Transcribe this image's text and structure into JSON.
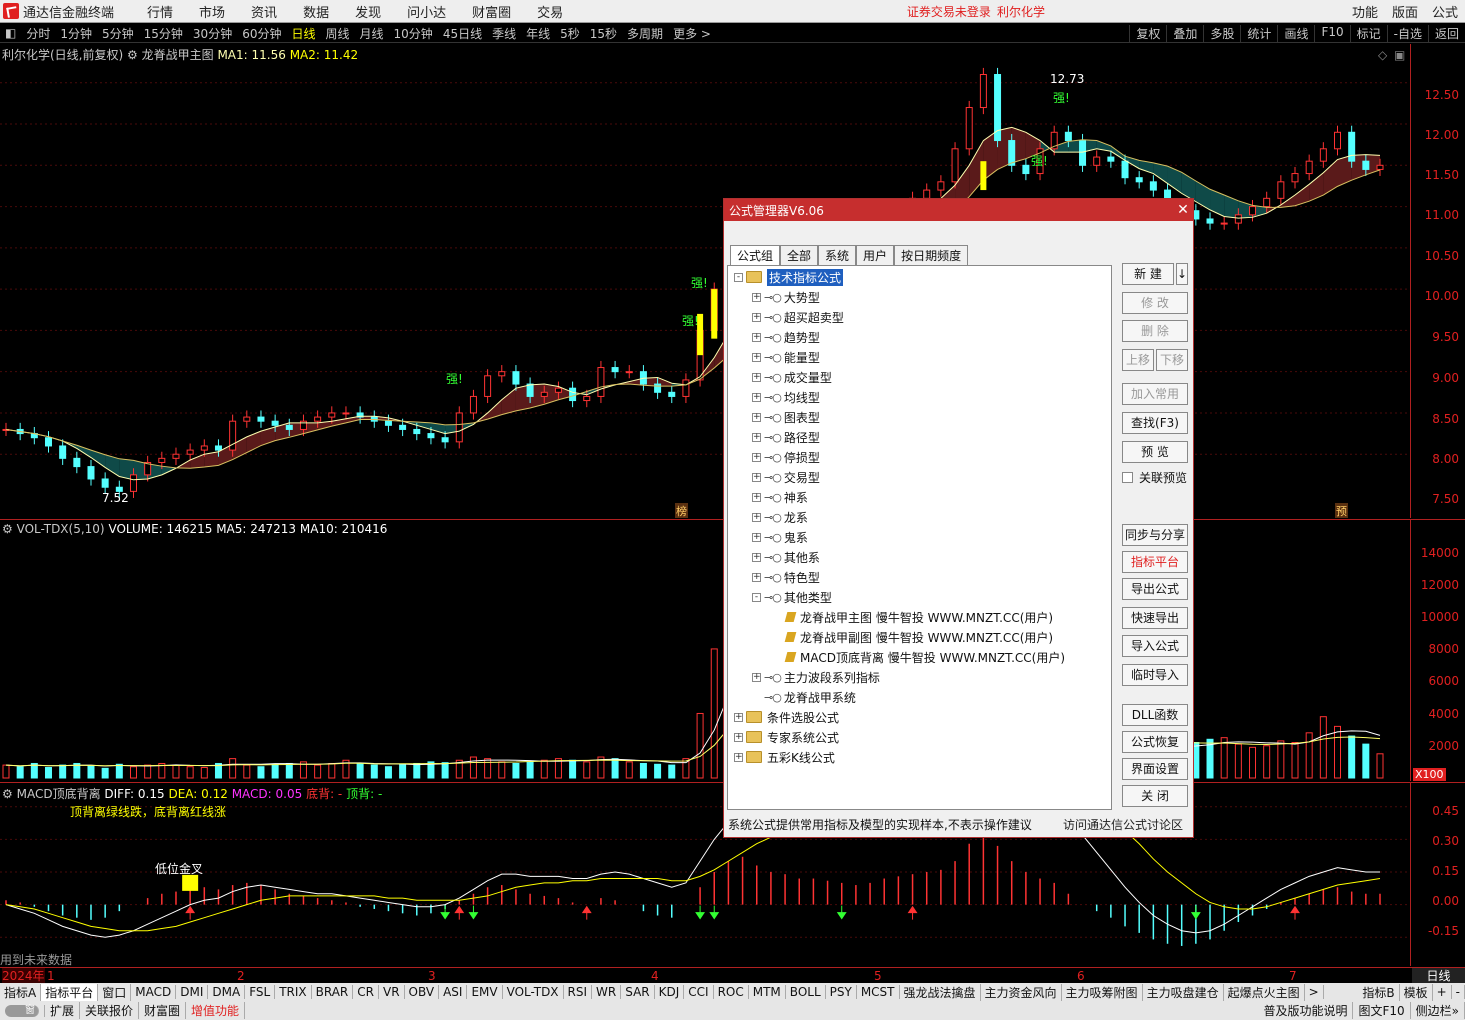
{
  "menubar": {
    "app_title": "通达信金融终端",
    "menus": [
      "行情",
      "市场",
      "资讯",
      "数据",
      "发现",
      "问小达",
      "财富圈",
      "交易"
    ],
    "notice": "证券交易未登录",
    "stock_name": "利尔化学",
    "right_menus": [
      "功能",
      "版面",
      "公式"
    ]
  },
  "toolbar": {
    "periods": [
      "分时",
      "1分钟",
      "5分钟",
      "15分钟",
      "30分钟",
      "60分钟",
      "日线",
      "周线",
      "月线",
      "10分钟",
      "45日线",
      "季线",
      "年线",
      "5秒",
      "15秒",
      "多周期",
      "更多 >"
    ],
    "active_period": "日线",
    "right_tools": [
      "复权",
      "叠加",
      "多股",
      "统计",
      "画线",
      "F10",
      "标记",
      "-自选",
      "返回"
    ]
  },
  "price_panel": {
    "title": "利尔化学(日线,前复权)",
    "indicator": "龙脊战甲主图",
    "ma1": "MA1: 11.56",
    "ma2": "MA2: 11.42",
    "high_label": "12.73",
    "low_label": "7.52",
    "strong_labels": [
      "强!",
      "强!",
      "强!",
      "强!",
      "强!"
    ],
    "bang_label": "榜",
    "yu_label": "预",
    "axis_ticks": [
      "12.50",
      "12.00",
      "11.50",
      "11.00",
      "10.50",
      "10.00",
      "9.50",
      "9.00",
      "8.50",
      "8.00",
      "7.50"
    ]
  },
  "volume_panel": {
    "title": "VOL-TDX(5,10)",
    "volume": "VOLUME: 146215",
    "ma5": "MA5: 247213",
    "ma10": "MA10: 210416",
    "axis_ticks": [
      "14000",
      "12000",
      "10000",
      "8000",
      "6000",
      "4000",
      "2000"
    ],
    "unit": "X100"
  },
  "macd_panel": {
    "title": "MACD顶底背离",
    "diff": "DIFF: 0.15",
    "dea": "DEA: 0.12",
    "macd": "MACD: 0.05",
    "bottom_div": "底背: -",
    "top_div": "顶背: -",
    "note": "顶背离绿线跌，底背离红线涨",
    "golden_cross": "低位金叉",
    "future_warning": "用到未来数据",
    "axis_ticks": [
      "0.45",
      "0.30",
      "0.15",
      "0.00",
      "-0.15"
    ]
  },
  "date_bar": {
    "year": "2024年",
    "months": [
      "1",
      "2",
      "3",
      "4",
      "5",
      "6",
      "7"
    ],
    "right_label": "日线"
  },
  "tab_bar_1": {
    "tabs": [
      "指标A",
      "指标平台",
      "窗口",
      "MACD",
      "DMI",
      "DMA",
      "FSL",
      "TRIX",
      "BRAR",
      "CR",
      "VR",
      "OBV",
      "ASI",
      "EMV",
      "VOL-TDX",
      "RSI",
      "WR",
      "SAR",
      "KDJ",
      "CCI",
      "ROC",
      "MTM",
      "BOLL",
      "PSY",
      "MCST",
      "强龙战法擒盘",
      "主力资金风向",
      "主力吸筹附图",
      "主力吸盘建仓",
      "起爆点火主图"
    ],
    "right": [
      "指标B",
      "模板",
      "+",
      "-"
    ]
  },
  "tab_bar_2": {
    "toggle": "窗",
    "tabs": [
      "扩展",
      "关联报价",
      "财富圈",
      "增值功能"
    ],
    "right": [
      "普及版功能说明",
      "图文F10",
      "侧边栏»"
    ]
  },
  "dialog": {
    "title": "公式管理器V6.06",
    "tabs": [
      "公式组",
      "全部",
      "系统",
      "用户",
      "按日期频度"
    ],
    "root": "技术指标公式",
    "categories": [
      "大势型",
      "超买超卖型",
      "趋势型",
      "能量型",
      "成交量型",
      "均线型",
      "图表型",
      "路径型",
      "停损型",
      "交易型",
      "神系",
      "龙系",
      "鬼系",
      "其他系",
      "特色型",
      "其他类型"
    ],
    "formulas": [
      "龙脊战甲主图  慢牛智投 WWW.MNZT.CC(用户)",
      "龙脊战甲副图  慢牛智投 WWW.MNZT.CC(用户)",
      "MACD顶底背离  慢牛智投 WWW.MNZT.CC(用户)"
    ],
    "after_items": [
      "主力波段系列指标",
      "龙脊战甲系统"
    ],
    "other_roots": [
      "条件选股公式",
      "专家系统公式",
      "五彩K线公式"
    ],
    "buttons_top": [
      "新  建",
      "修  改",
      "删  除"
    ],
    "move_up": "上移",
    "move_down": "下移",
    "btn_add_common": "加入常用",
    "btn_find": "查找(F3)",
    "btn_preview": "预  览",
    "chk_link": "关联预览",
    "buttons_mid": [
      "同步与分享",
      "指标平台",
      "导出公式",
      "快速导出",
      "导入公式",
      "临时导入"
    ],
    "buttons_bot": [
      "DLL函数",
      "公式恢复",
      "界面设置",
      "关  闭"
    ],
    "footer_left": "系统公式提供常用指标及模型的实现样本,不表示操作建议",
    "footer_right": "访问通达信公式讨论区",
    "arrow": "↓",
    "close": "✕"
  },
  "colors": {
    "up": "#ff3333",
    "down": "#54ffff",
    "accent_red": "#c62e2e",
    "ma_yellow": "#ffffb0",
    "highlight_yellow": "#ffff00"
  },
  "chart_data": {
    "type": "candlestick",
    "x_range_months": [
      "1",
      "2",
      "3",
      "4",
      "5",
      "6",
      "7"
    ],
    "price_ylim": [
      7.3,
      12.8
    ],
    "price_series": [
      8.3,
      8.25,
      8.2,
      8.1,
      7.95,
      7.85,
      7.7,
      7.6,
      7.55,
      7.75,
      7.9,
      7.95,
      8.0,
      8.05,
      8.1,
      8.05,
      8.4,
      8.45,
      8.4,
      8.35,
      8.3,
      8.4,
      8.45,
      8.5,
      8.5,
      8.45,
      8.4,
      8.35,
      8.3,
      8.25,
      8.2,
      8.15,
      8.5,
      8.7,
      8.95,
      9.0,
      8.85,
      8.7,
      8.75,
      8.8,
      8.65,
      8.7,
      9.05,
      9.0,
      9.0,
      8.85,
      8.75,
      8.7,
      8.9,
      9.5,
      10.0,
      10.2,
      10.3,
      10.1,
      10.3,
      10.5,
      10.3,
      10.4,
      10.5,
      10.6,
      10.5,
      10.7,
      10.9,
      11.0,
      11.1,
      11.2,
      11.3,
      11.7,
      12.2,
      12.6,
      11.8,
      11.5,
      11.4,
      11.7,
      11.9,
      11.8,
      11.5,
      11.6,
      11.55,
      11.35,
      11.3,
      11.2,
      11.0,
      10.95,
      10.85,
      10.8,
      10.8,
      10.9,
      11.0,
      11.1,
      11.3,
      11.4,
      11.55,
      11.7,
      11.9,
      11.55,
      11.45,
      11.5
    ],
    "price_high": "12.73",
    "price_low": "7.52",
    "volume_ylim": [
      0,
      15000
    ],
    "volume_series": [
      800,
      700,
      900,
      650,
      800,
      900,
      750,
      600,
      850,
      700,
      800,
      900,
      800,
      700,
      650,
      900,
      1200,
      800,
      700,
      850,
      900,
      1000,
      800,
      900,
      1100,
      900,
      800,
      700,
      850,
      900,
      1000,
      950,
      1100,
      1300,
      1200,
      1000,
      900,
      1000,
      1100,
      1200,
      1100,
      1000,
      1300,
      1200,
      1000,
      900,
      850,
      800,
      1200,
      4000,
      8000,
      11500,
      9000,
      6000,
      5000,
      4000,
      3500,
      4200,
      4800,
      3500,
      3000,
      3200,
      3500,
      2800,
      3000,
      3200,
      3400,
      5200,
      9500,
      8000,
      6000,
      4500,
      3800,
      3500,
      3200,
      2600,
      2400,
      2500,
      2300,
      2100,
      2000,
      1800,
      1900,
      2000,
      2200,
      2400,
      2500,
      2100,
      1900,
      2000,
      2300,
      2200,
      2800,
      3800,
      3200,
      2600,
      2100,
      1500
    ],
    "macd_ylim": [
      -0.25,
      0.55
    ],
    "macd_hist": [
      0.02,
      0.01,
      -0.01,
      -0.03,
      -0.05,
      -0.06,
      -0.07,
      -0.06,
      -0.03,
      0.0,
      0.03,
      0.05,
      0.06,
      0.07,
      0.08,
      0.07,
      0.09,
      0.1,
      0.09,
      0.07,
      0.05,
      0.04,
      0.03,
      0.02,
      0.01,
      -0.01,
      -0.02,
      -0.03,
      -0.04,
      -0.05,
      -0.04,
      -0.02,
      0.02,
      0.05,
      0.08,
      0.09,
      0.07,
      0.05,
      0.04,
      0.03,
      0.01,
      0.0,
      0.03,
      0.02,
      0.0,
      -0.03,
      -0.05,
      -0.06,
      0.0,
      0.08,
      0.15,
      0.2,
      0.22,
      0.18,
      0.15,
      0.14,
      0.12,
      0.12,
      0.11,
      0.1,
      0.09,
      0.1,
      0.12,
      0.13,
      0.14,
      0.15,
      0.16,
      0.2,
      0.28,
      0.32,
      0.27,
      0.2,
      0.15,
      0.12,
      0.1,
      0.05,
      0.0,
      -0.03,
      -0.06,
      -0.1,
      -0.13,
      -0.16,
      -0.18,
      -0.19,
      -0.18,
      -0.16,
      -0.12,
      -0.08,
      -0.05,
      -0.02,
      0.01,
      0.03,
      0.05,
      0.07,
      0.08,
      0.06,
      0.05,
      0.05
    ],
    "macd_diff": [
      0.0,
      -0.02,
      -0.04,
      -0.07,
      -0.1,
      -0.12,
      -0.14,
      -0.15,
      -0.14,
      -0.12,
      -0.09,
      -0.06,
      -0.03,
      0.0,
      0.02,
      0.03,
      0.06,
      0.08,
      0.09,
      0.08,
      0.07,
      0.06,
      0.05,
      0.05,
      0.04,
      0.03,
      0.02,
      0.01,
      0.0,
      -0.01,
      -0.01,
      0.0,
      0.03,
      0.07,
      0.11,
      0.14,
      0.14,
      0.13,
      0.13,
      0.13,
      0.12,
      0.12,
      0.14,
      0.15,
      0.14,
      0.12,
      0.1,
      0.08,
      0.1,
      0.2,
      0.3,
      0.38,
      0.43,
      0.44,
      0.44,
      0.45,
      0.45,
      0.46,
      0.47,
      0.47,
      0.47,
      0.48,
      0.5,
      0.52,
      0.54,
      0.56,
      0.58,
      0.62,
      0.7,
      0.78,
      0.75,
      0.68,
      0.6,
      0.54,
      0.48,
      0.4,
      0.32,
      0.24,
      0.16,
      0.08,
      0.01,
      -0.05,
      -0.09,
      -0.12,
      -0.13,
      -0.12,
      -0.09,
      -0.05,
      -0.01,
      0.03,
      0.07,
      0.1,
      0.13,
      0.15,
      0.17,
      0.16,
      0.15,
      0.15
    ],
    "macd_dea": [
      0.0,
      -0.01,
      -0.02,
      -0.04,
      -0.06,
      -0.08,
      -0.1,
      -0.11,
      -0.12,
      -0.12,
      -0.12,
      -0.11,
      -0.1,
      -0.08,
      -0.06,
      -0.04,
      -0.02,
      0.0,
      0.02,
      0.03,
      0.04,
      0.04,
      0.04,
      0.04,
      0.04,
      0.04,
      0.04,
      0.03,
      0.03,
      0.02,
      0.02,
      0.02,
      0.02,
      0.03,
      0.04,
      0.06,
      0.08,
      0.09,
      0.1,
      0.1,
      0.11,
      0.11,
      0.12,
      0.12,
      0.12,
      0.12,
      0.12,
      0.11,
      0.11,
      0.13,
      0.16,
      0.2,
      0.24,
      0.28,
      0.31,
      0.34,
      0.36,
      0.38,
      0.4,
      0.42,
      0.43,
      0.44,
      0.45,
      0.46,
      0.47,
      0.49,
      0.5,
      0.52,
      0.55,
      0.6,
      0.63,
      0.64,
      0.63,
      0.61,
      0.58,
      0.55,
      0.5,
      0.45,
      0.4,
      0.34,
      0.28,
      0.21,
      0.15,
      0.1,
      0.05,
      0.01,
      -0.01,
      -0.02,
      -0.02,
      -0.01,
      0.01,
      0.03,
      0.05,
      0.07,
      0.09,
      0.1,
      0.11,
      0.12
    ]
  }
}
